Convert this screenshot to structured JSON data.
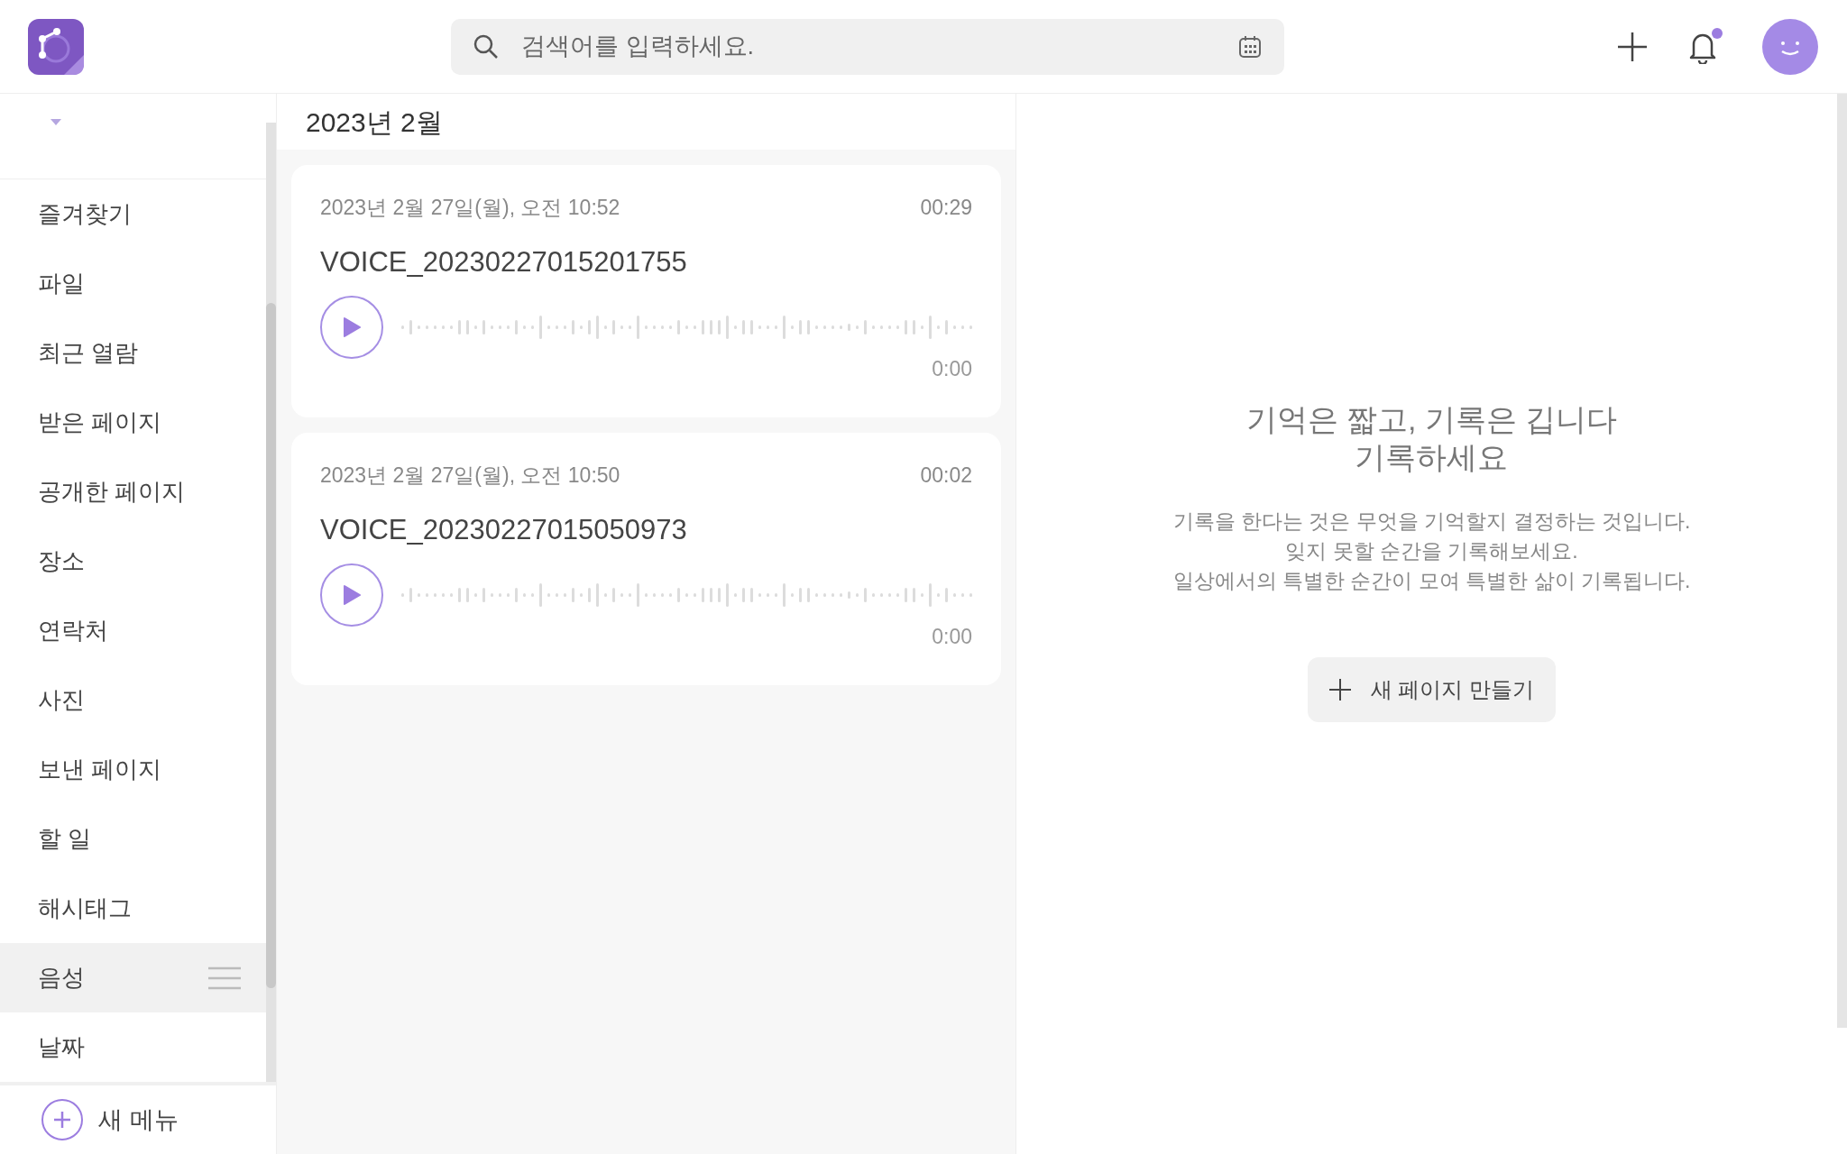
{
  "search": {
    "placeholder": "검색어를 입력하세요."
  },
  "notifications": {
    "unread": true
  },
  "sidebar": {
    "items": [
      {
        "label": "즐겨찾기",
        "selected": false
      },
      {
        "label": "파일",
        "selected": false
      },
      {
        "label": "최근 열람",
        "selected": false
      },
      {
        "label": "받은 페이지",
        "selected": false
      },
      {
        "label": "공개한 페이지",
        "selected": false
      },
      {
        "label": "장소",
        "selected": false
      },
      {
        "label": "연락처",
        "selected": false
      },
      {
        "label": "사진",
        "selected": false
      },
      {
        "label": "보낸 페이지",
        "selected": false
      },
      {
        "label": "할 일",
        "selected": false
      },
      {
        "label": "해시태그",
        "selected": false
      },
      {
        "label": "음성",
        "selected": true
      },
      {
        "label": "날짜",
        "selected": false
      }
    ],
    "new_menu": "새 메뉴"
  },
  "list": {
    "month": "2023년 2월",
    "recordings": [
      {
        "date": "2023년 2월 27일(월), 오전 10:52",
        "duration": "00:29",
        "title": "VOICE_20230227015201755",
        "position": "0:00"
      },
      {
        "date": "2023년 2월 27일(월), 오전 10:50",
        "duration": "00:02",
        "title": "VOICE_20230227015050973",
        "position": "0:00"
      }
    ]
  },
  "empty_state": {
    "heading": [
      "기억은 짧고, 기록은 깁니다",
      "기록하세요"
    ],
    "lines": [
      "기록을 한다는 것은 무엇을 기억할지 결정하는 것입니다.",
      "잊지 못할 순간을 기록해보세요.",
      "일상에서의 특별한 순간이 모여 특별한 삶이 기록됩니다."
    ],
    "button": "새 페이지 만들기"
  }
}
